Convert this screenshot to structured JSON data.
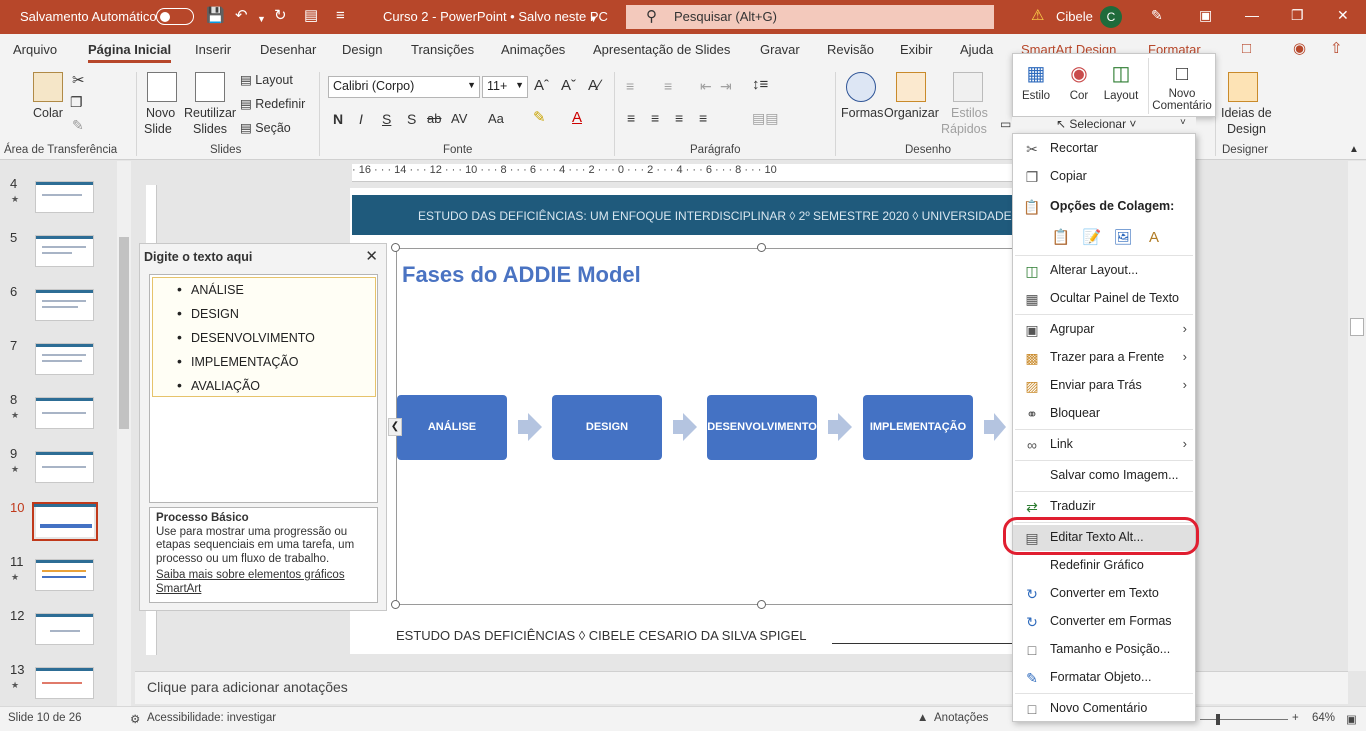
{
  "titlebar": {
    "autosave_label": "Salvamento Automático",
    "doc_title": "Curso 2 - PowerPoint • Salvo neste PC",
    "search_placeholder": "Pesquisar (Alt+G)",
    "user_name": "Cibele",
    "user_initial": "C",
    "accent": "#b7472a"
  },
  "tabs": [
    "Arquivo",
    "Página Inicial",
    "Inserir",
    "Desenhar",
    "Design",
    "Transições",
    "Animações",
    "Apresentação de Slides",
    "Gravar",
    "Revisão",
    "Exibir",
    "Ajuda",
    "SmartArt Design",
    "Formatar"
  ],
  "ribbon": {
    "paste": "Colar",
    "new_slide": [
      "Novo",
      "Slide"
    ],
    "reuse": [
      "Reutilizar",
      "Slides"
    ],
    "layout": "Layout",
    "reset": "Redefinir",
    "section": "Seção",
    "font_name": "Calibri (Corpo)",
    "font_size": "11+",
    "shapes": "Formas",
    "arrange": "Organizar",
    "quick_styles": [
      "Estilos",
      "Rápidos"
    ],
    "select": "Selecionar",
    "designer": [
      "Ideias de",
      "Design"
    ],
    "groups": [
      "Área de Transferência",
      "Slides",
      "Fonte",
      "Parágrafo",
      "Desenho",
      "Designer"
    ]
  },
  "thumbnails": [
    {
      "num": "4",
      "star": true
    },
    {
      "num": "5",
      "star": false
    },
    {
      "num": "6",
      "star": false
    },
    {
      "num": "7",
      "star": false
    },
    {
      "num": "8",
      "star": true
    },
    {
      "num": "9",
      "star": true
    },
    {
      "num": "10",
      "star": false
    },
    {
      "num": "11",
      "star": true
    },
    {
      "num": "12",
      "star": false
    },
    {
      "num": "13",
      "star": true
    }
  ],
  "slide": {
    "header": "ESTUDO DAS DEFICIÊNCIAS: UM ENFOQUE INTERDISCIPLINAR ◊  2º SEMESTRE 2020  ◊  UNIVERSIDADE PRESB",
    "title": "Fases do ADDIE Model",
    "boxes": [
      "ANÁLISE",
      "DESIGN",
      "DESENVOLVIMENTO",
      "IMPLEMENTAÇÃO"
    ],
    "footer": "ESTUDO DAS DEFICIÊNCIAS  ◊  CIBELE CESARIO DA SILVA SPIGEL",
    "ruler_text": "· 16 · · · 14 · · · 12 · · · 10 · · · 8 · · · 6 · · · 4 · · · 2 · · · 0 · · · 2 · · · 4 · · · 6 · · · 8 · · · 10"
  },
  "text_pane": {
    "title": "Digite o texto aqui",
    "bullets": [
      "ANÁLISE",
      "DESIGN",
      "DESENVOLVIMENTO",
      "IMPLEMENTAÇÃO",
      "AVALIAÇÃO"
    ],
    "desc_title": "Processo Básico",
    "desc_body": "Use para mostrar uma progressão ou etapas sequenciais em uma tarefa, um processo ou um fluxo de trabalho.",
    "desc_link": "Saiba mais sobre elementos gráficos SmartArt"
  },
  "mini_toolbar": {
    "style": "Estilo",
    "color": "Cor",
    "layout": "Layout",
    "new_comment": [
      "Novo",
      "Comentário"
    ],
    "select": "Selecionar"
  },
  "context_menu": {
    "items": [
      {
        "label": "Recortar",
        "icon": "scissors-icon"
      },
      {
        "label": "Copiar",
        "icon": "copy-icon"
      },
      {
        "label": "Opções de Colagem:",
        "icon": "paste-options-icon"
      },
      {
        "label": "Alterar Layout...",
        "icon": "change-layout-icon"
      },
      {
        "label": "Ocultar Painel de Texto",
        "icon": "text-pane-icon"
      },
      {
        "label": "Agrupar",
        "icon": "group-icon"
      },
      {
        "label": "Trazer para a Frente",
        "icon": "bring-forward-icon"
      },
      {
        "label": "Enviar para Trás",
        "icon": "send-backward-icon"
      },
      {
        "label": "Bloquear",
        "icon": "lock-icon"
      },
      {
        "label": "Link",
        "icon": "link-icon"
      },
      {
        "label": "Salvar como Imagem...",
        "icon": ""
      },
      {
        "label": "Traduzir",
        "icon": "translate-icon"
      },
      {
        "label": "Editar Texto Alt...",
        "icon": "alt-text-icon"
      },
      {
        "label": "Redefinir Gráfico",
        "icon": ""
      },
      {
        "label": "Converter em Texto",
        "icon": "convert-text-icon"
      },
      {
        "label": "Converter em Formas",
        "icon": "convert-shapes-icon"
      },
      {
        "label": "Tamanho e Posição...",
        "icon": "size-position-icon"
      },
      {
        "label": "Formatar Objeto...",
        "icon": "format-object-icon"
      },
      {
        "label": "Novo Comentário",
        "icon": "comment-icon"
      }
    ],
    "highlight_color": "#e01e30"
  },
  "notes": {
    "placeholder": "Clique para adicionar anotações"
  },
  "status": {
    "slide_of": "Slide 10 de 26",
    "accessibility": "Acessibilidade: investigar",
    "notes_btn": "Anotações",
    "zoom": "64%"
  }
}
